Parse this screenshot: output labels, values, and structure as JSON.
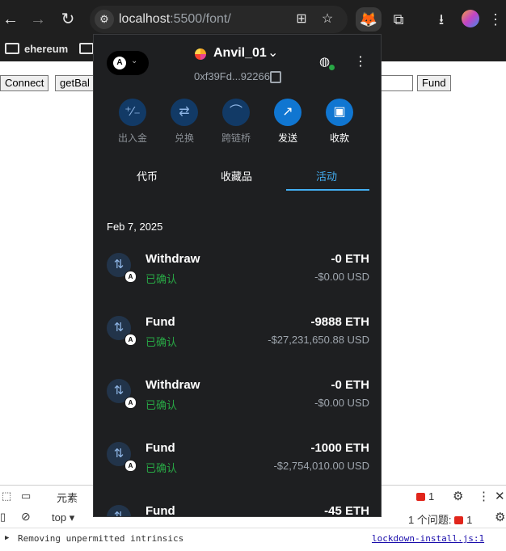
{
  "browser": {
    "url_host": "localhost",
    "url_path": ":5500/font/",
    "bookmarks": [
      "ehereum"
    ]
  },
  "page": {
    "connect_label": "Connect",
    "getbal_label": "getBal",
    "fund_label": "Fund"
  },
  "devtools": {
    "tab_elements": "元素",
    "err_count_top": "1",
    "context": "top",
    "issues_label": "1 个问题:",
    "issues_count": "1",
    "console_message": "Removing unpermitted intrinsics",
    "console_source": "lockdown-install.js:1"
  },
  "wallet": {
    "account_letter": "A",
    "account_name": "Anvil_01",
    "address": "0xf39Fd...92266",
    "actions": [
      {
        "label": "出入金",
        "icon": "plus-minus-icon"
      },
      {
        "label": "兑换",
        "icon": "swap-icon"
      },
      {
        "label": "跨链桥",
        "icon": "bridge-icon"
      },
      {
        "label": "发送",
        "icon": "send-icon"
      },
      {
        "label": "收款",
        "icon": "receive-icon"
      }
    ],
    "tabs": [
      "代币",
      "收藏品",
      "活动"
    ],
    "active_tab": "活动",
    "activity_date": "Feb 7, 2025",
    "transactions": [
      {
        "title": "Withdraw",
        "status": "已确认",
        "amount": "-0 ETH",
        "fiat": "-$0.00 USD"
      },
      {
        "title": "Fund",
        "status": "已确认",
        "amount": "-9888 ETH",
        "fiat": "-$27,231,650.88 USD"
      },
      {
        "title": "Withdraw",
        "status": "已确认",
        "amount": "-0 ETH",
        "fiat": "-$0.00 USD"
      },
      {
        "title": "Fund",
        "status": "已确认",
        "amount": "-1000 ETH",
        "fiat": "-$2,754,010.00 USD"
      },
      {
        "title": "Fund",
        "status": "",
        "amount": "-45 ETH",
        "fiat": ""
      }
    ]
  },
  "colors": {
    "chrome_bg": "#1f1f1f",
    "wallet_bg": "#1e1f21",
    "accent_blue": "#43aef2",
    "confirmed_green": "#28a745"
  }
}
